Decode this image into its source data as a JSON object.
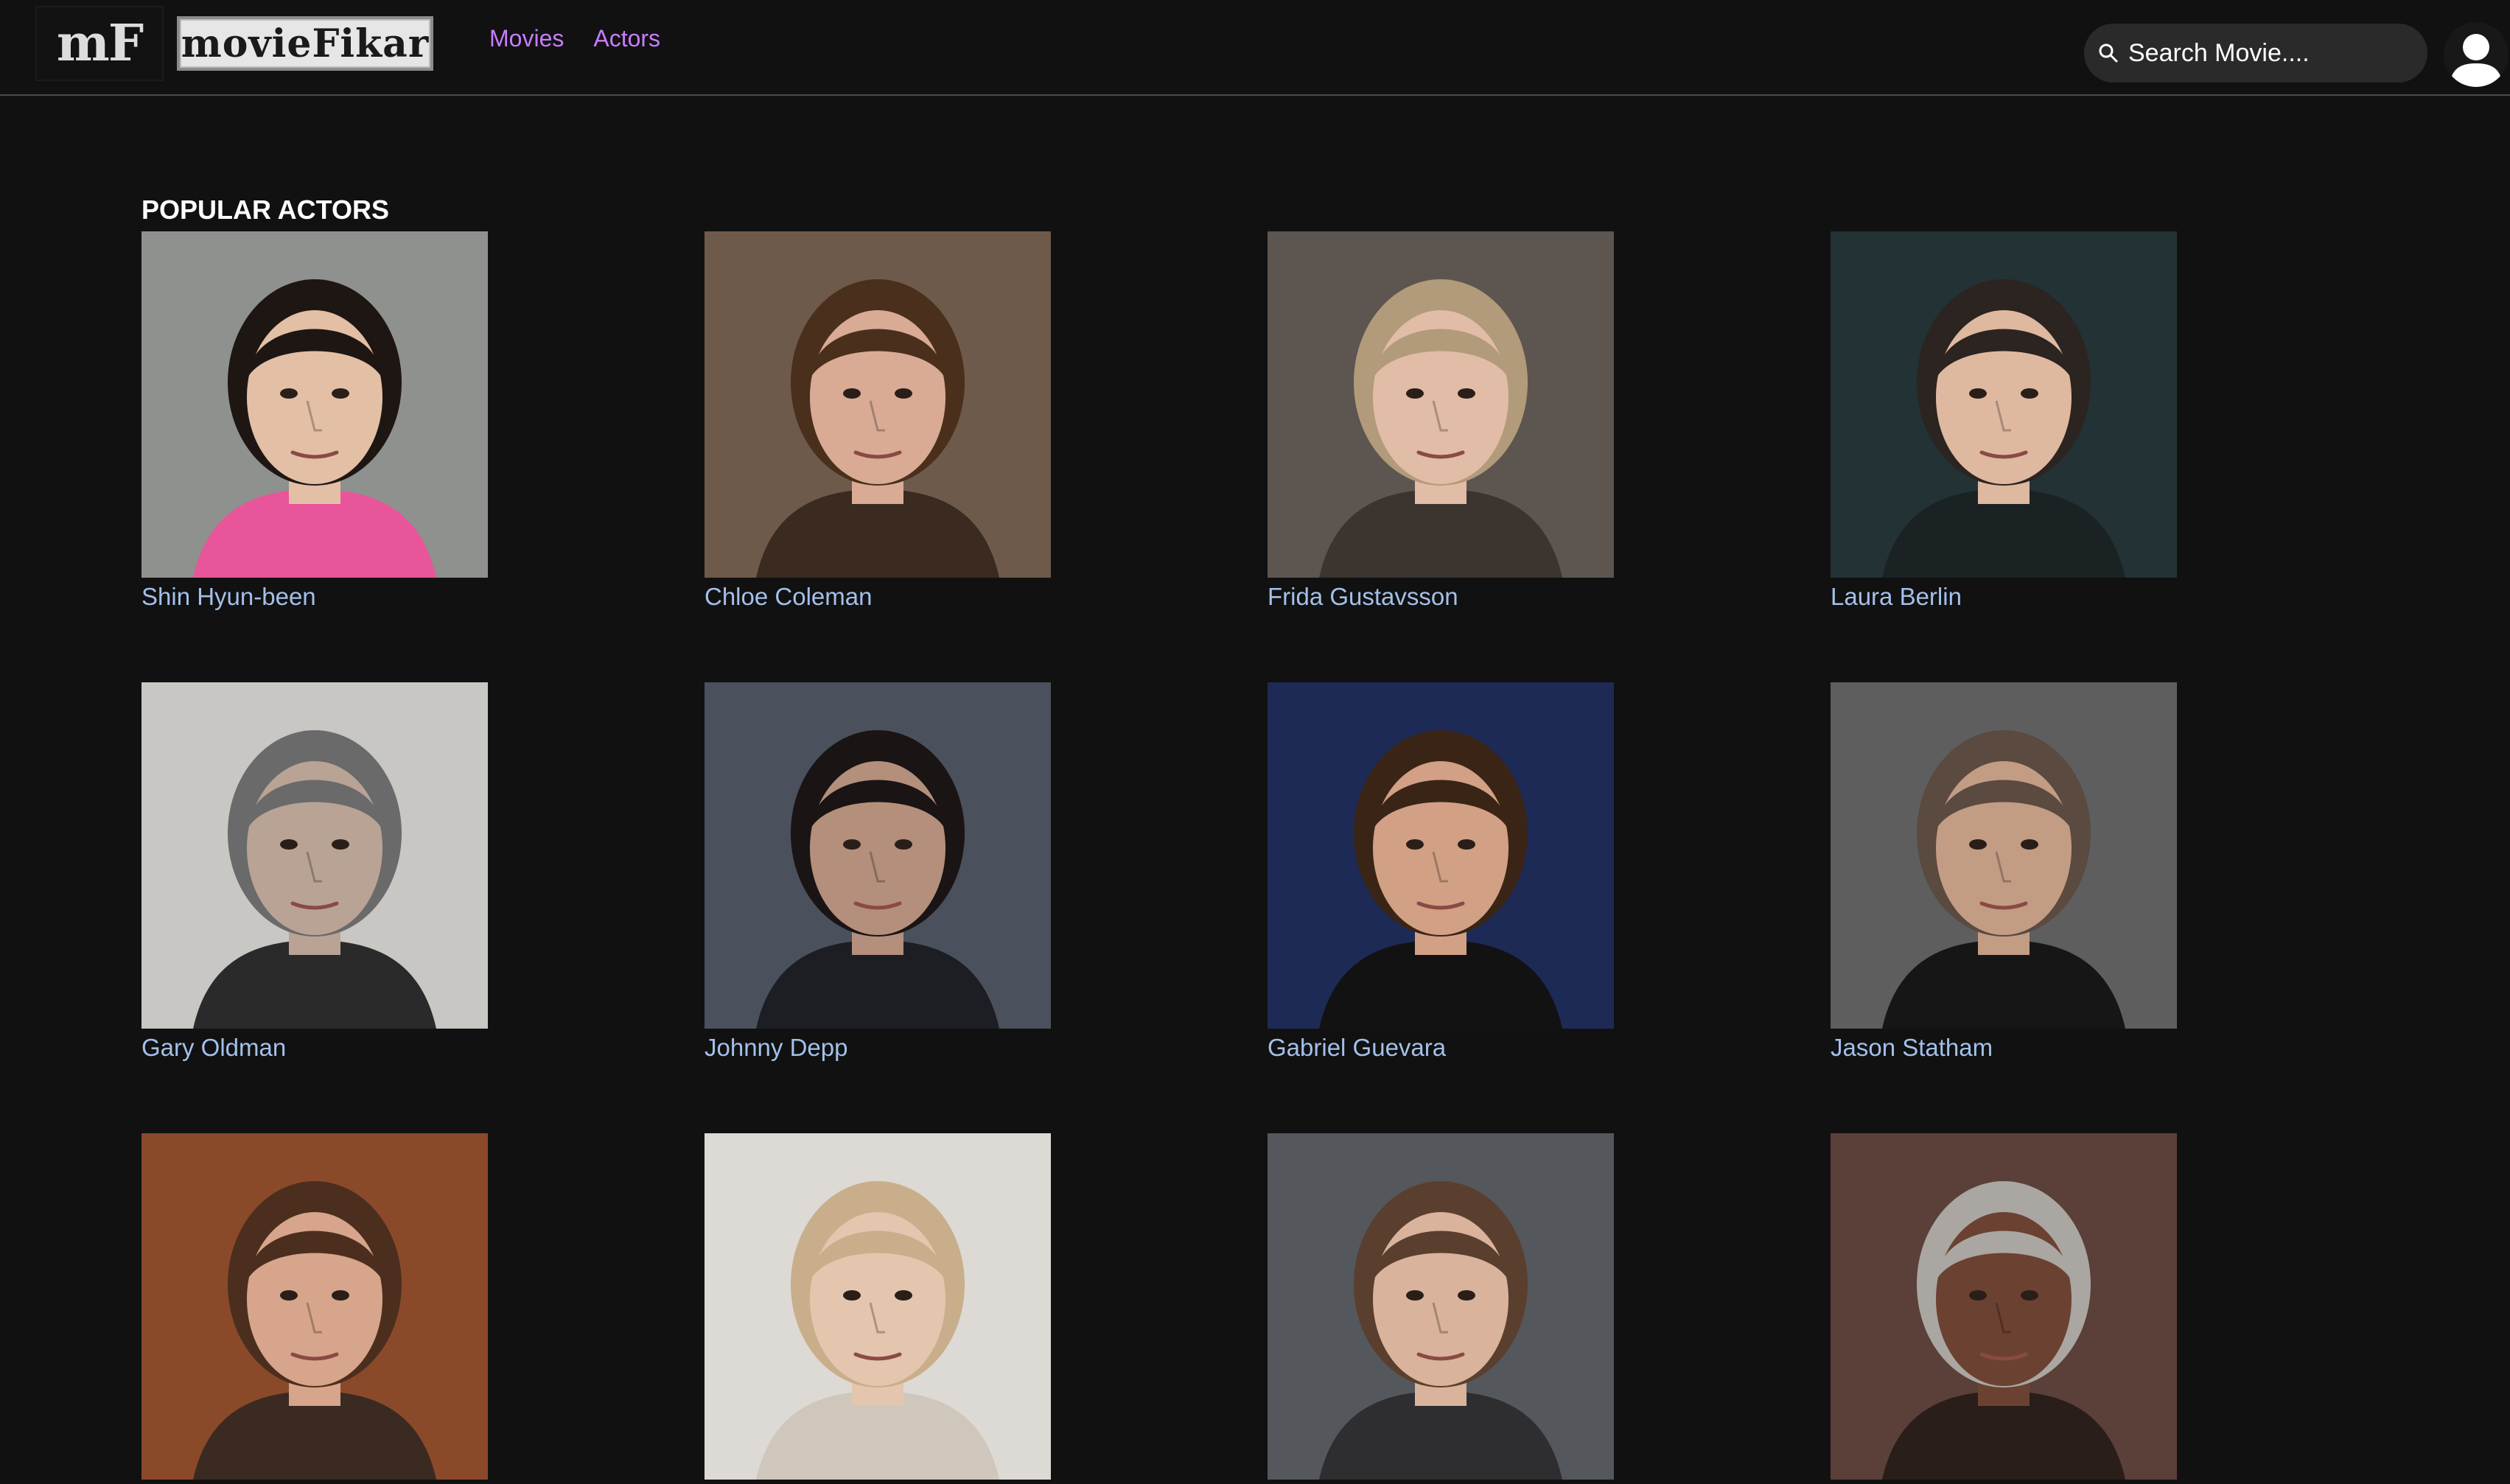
{
  "navbar": {
    "logo_mark": "mF",
    "logo_word": "movieFikar",
    "links": [
      {
        "label": "Movies"
      },
      {
        "label": "Actors"
      }
    ],
    "search": {
      "placeholder": "Search Movie....",
      "icon": "search-icon"
    },
    "avatar_icon": "user-icon"
  },
  "section": {
    "title": "POPULAR ACTORS"
  },
  "actors": [
    {
      "name": "Shin Hyun-been",
      "bg": "#8e918e",
      "skin": "#e3bfa6",
      "hair": "#1e1613",
      "shirt": "#e9559a"
    },
    {
      "name": "Chloe Coleman",
      "bg": "#6e5a4b",
      "skin": "#d9ab94",
      "hair": "#4a2f1d",
      "shirt": "#3a2a20"
    },
    {
      "name": "Frida Gustavsson",
      "bg": "#5d5550",
      "skin": "#e1bca6",
      "hair": "#b29b7a",
      "shirt": "#3b342f"
    },
    {
      "name": "Laura Berlin",
      "bg": "#233234",
      "skin": "#dfb8a0",
      "hair": "#2b2420",
      "shirt": "#1b2224"
    },
    {
      "name": "Gary Oldman",
      "bg": "#c8c7c4",
      "skin": "#b9a395",
      "hair": "#6a6a6a",
      "shirt": "#2a2a2a"
    },
    {
      "name": "Johnny Depp",
      "bg": "#4a505c",
      "skin": "#b38f7c",
      "hair": "#1a1414",
      "shirt": "#1c1e24"
    },
    {
      "name": "Gabriel Guevara",
      "bg": "#1d2a55",
      "skin": "#d1a085",
      "hair": "#3a2416",
      "shirt": "#121212"
    },
    {
      "name": "Jason Statham",
      "bg": "#5e5e5e",
      "skin": "#c39c84",
      "hair": "#5a4a40",
      "shirt": "#161616"
    },
    {
      "name": "",
      "bg": "#8a4a2a",
      "skin": "#d7a58b",
      "hair": "#4b2e1e",
      "shirt": "#3a2a22"
    },
    {
      "name": "",
      "bg": "#ddd9d4",
      "skin": "#e4c5ae",
      "hair": "#c8ae8a",
      "shirt": "#cfc6bc"
    },
    {
      "name": "",
      "bg": "#54575c",
      "skin": "#d9b39b",
      "hair": "#5a3f2e",
      "shirt": "#2e2e30"
    },
    {
      "name": "",
      "bg": "#5a4038",
      "skin": "#6b4132",
      "hair": "#aaa6a2",
      "shirt": "#2a1e1a"
    }
  ]
}
